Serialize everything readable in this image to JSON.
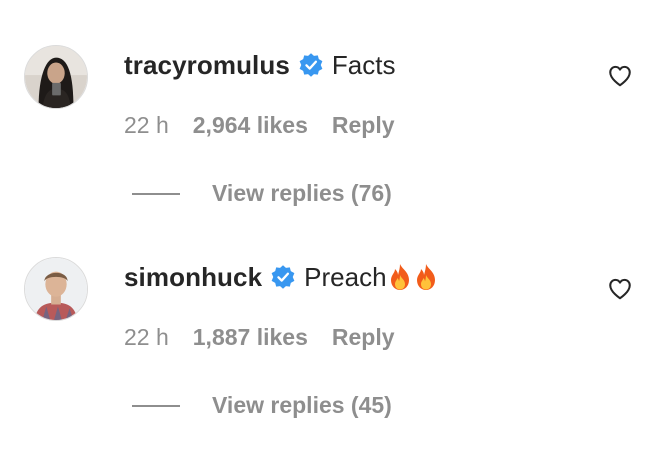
{
  "comments": [
    {
      "username": "tracyromulus",
      "verified": true,
      "text": "Facts",
      "emoji": [],
      "time": "22 h",
      "likes": "2,964 likes",
      "reply_label": "Reply",
      "view_replies": "View replies (76)",
      "avatar_icon": "profile-photo-dark-hair",
      "like_icon": "heart-outline-icon"
    },
    {
      "username": "simonhuck",
      "verified": true,
      "text": "Preach ",
      "emoji": [
        "fire",
        "fire"
      ],
      "time": "22 h",
      "likes": "1,887 likes",
      "reply_label": "Reply",
      "view_replies": "View replies (45)",
      "avatar_icon": "profile-photo-man",
      "like_icon": "heart-outline-icon"
    }
  ],
  "colors": {
    "primary_text": "#262626",
    "secondary_text": "#8e8e8e",
    "verified_blue": "#3897f0"
  }
}
